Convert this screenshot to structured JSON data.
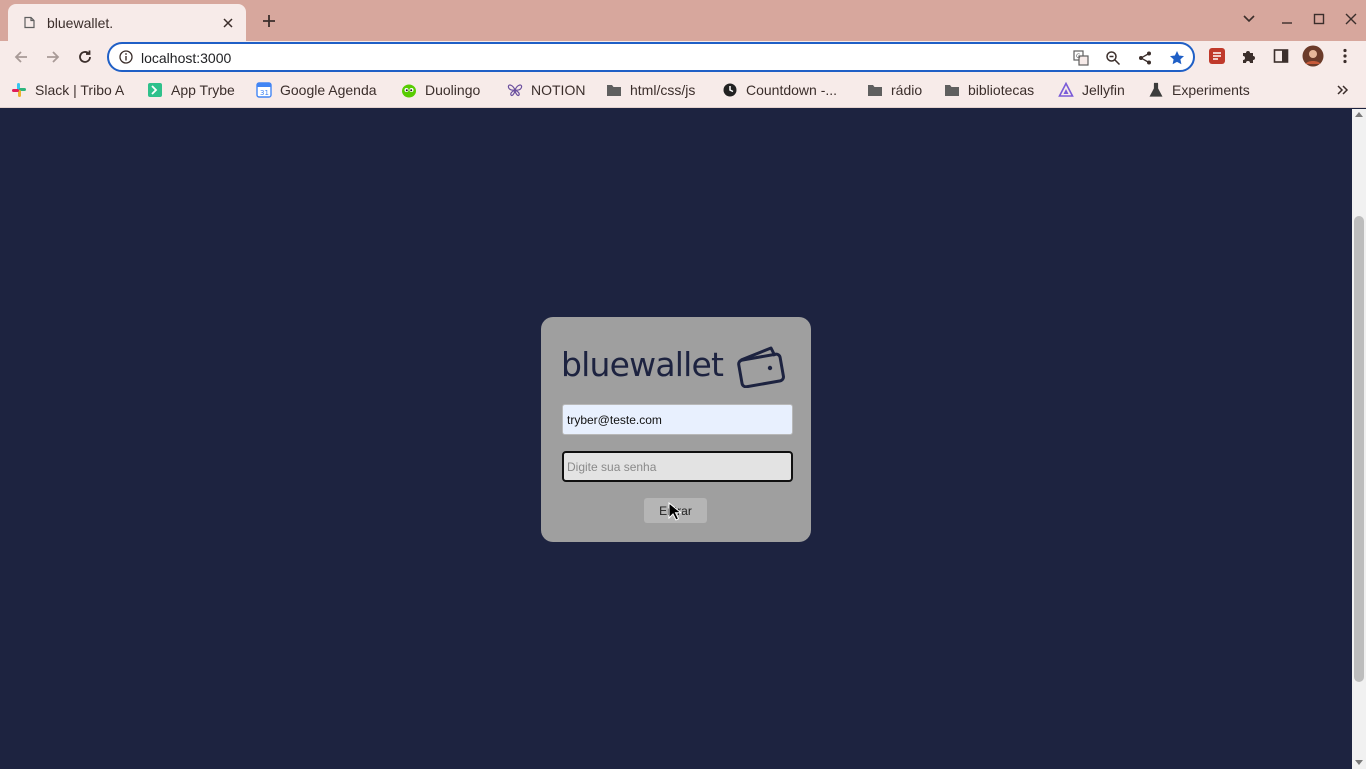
{
  "browser": {
    "tab": {
      "title": "bluewallet.",
      "favicon": "page-icon"
    },
    "address_bar": {
      "url": "localhost:3000"
    },
    "bookmarks": [
      {
        "label": "Slack | Tribo A",
        "icon": "slack-icon",
        "color": "#e01e5a"
      },
      {
        "label": "App Trybe",
        "icon": "trybe-icon",
        "color": "#2fc18c"
      },
      {
        "label": "Google Agenda",
        "icon": "calendar-icon",
        "color": "#4285f4"
      },
      {
        "label": "Duolingo",
        "icon": "duolingo-icon",
        "color": "#58cc02"
      },
      {
        "label": "NOTION",
        "icon": "butterfly-icon",
        "color": "#6b4f9e"
      },
      {
        "label": "html/css/js",
        "icon": "folder-icon",
        "color": "#5f5f5f"
      },
      {
        "label": "Countdown -...",
        "icon": "countdown-icon",
        "color": "#222222"
      },
      {
        "label": "rádio",
        "icon": "folder-icon",
        "color": "#5f5f5f"
      },
      {
        "label": "bibliotecas",
        "icon": "folder-icon",
        "color": "#5f5f5f"
      },
      {
        "label": "Jellyfin",
        "icon": "jellyfin-icon",
        "color": "#7a5bd8"
      },
      {
        "label": "Experiments",
        "icon": "flask-icon",
        "color": "#3c3c3c"
      }
    ]
  },
  "page": {
    "background_color": "#1d2340",
    "card_color": "#9f9f9f",
    "logo": {
      "text": "bluewallet",
      "icon": "wallet-icon"
    },
    "email": {
      "value": "tryber@teste.com"
    },
    "password": {
      "placeholder": "Digite sua senha",
      "value": ""
    },
    "submit": {
      "label": "Entrar"
    }
  }
}
